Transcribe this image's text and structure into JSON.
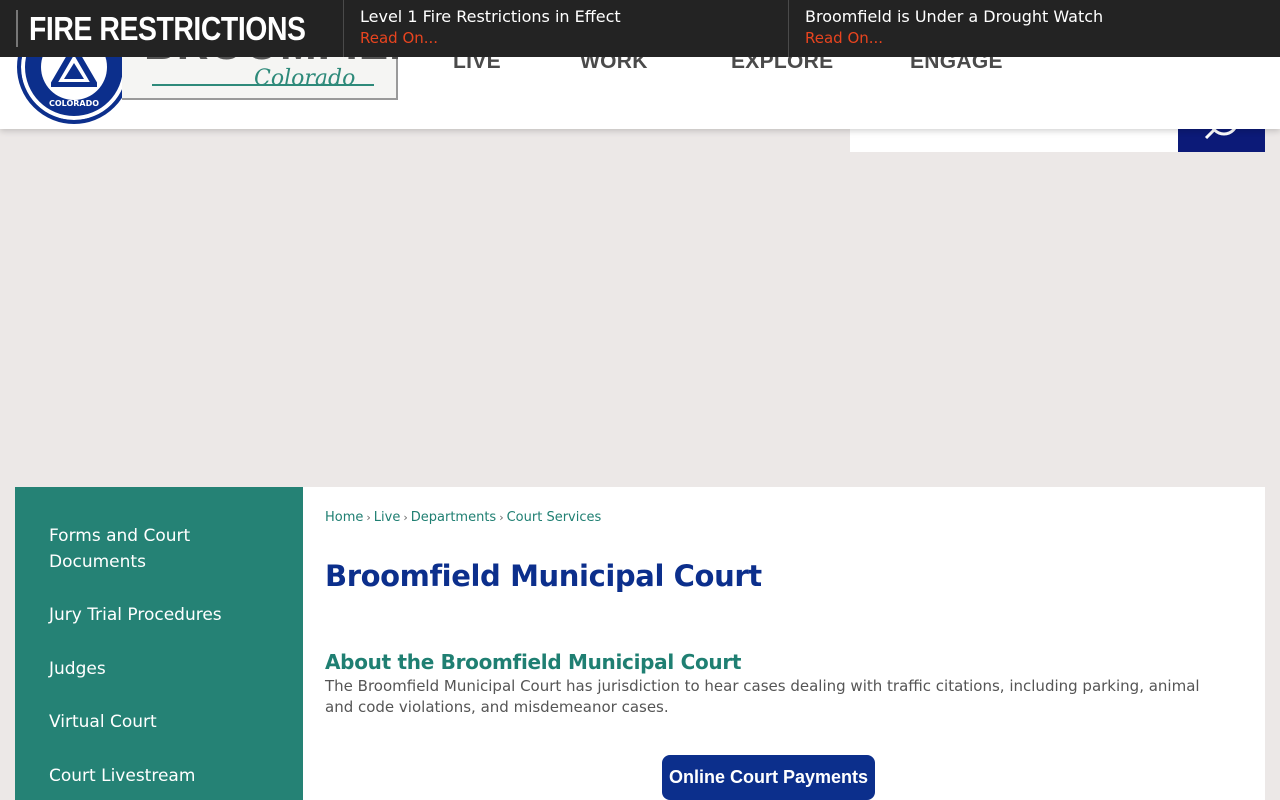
{
  "alerts": {
    "banner_title": "FIRE RESTRICTIONS",
    "items": [
      {
        "title": "Level 1 Fire Restrictions in Effect",
        "link": "Read On..."
      },
      {
        "title": "Broomfield is Under a Drought Watch",
        "link": "Read On..."
      }
    ]
  },
  "header": {
    "logo": {
      "wordmark": "BROOMFIELD",
      "script": "Colorado",
      "seal_text": "COLORADO"
    },
    "nav": [
      "LIVE",
      "WORK",
      "EXPLORE",
      "ENGAGE"
    ]
  },
  "search": {
    "placeholder": "",
    "button_icon": "search-icon"
  },
  "sidebar": {
    "items": [
      {
        "label": "Forms and Court Documents"
      },
      {
        "label": "Jury Trial Procedures"
      },
      {
        "label": "Judges"
      },
      {
        "label": "Virtual Court"
      },
      {
        "label": "Court Livestream"
      }
    ]
  },
  "breadcrumb": [
    "Home",
    "Live",
    "Departments",
    "Court Services"
  ],
  "page": {
    "title": "Broomfield Municipal Court",
    "section_heading": "About the Broomfield Municipal Court",
    "section_body": "The Broomfield Municipal Court has jurisdiction to hear cases dealing with traffic citations, including parking, animal and code violations, and misdemeanor cases.",
    "payments_button": "Online Court Payments"
  },
  "colors": {
    "alert_bar": "#232323",
    "alert_link": "#e8441f",
    "primary_blue": "#0c2f8c",
    "teal": "#258275",
    "page_bg": "#ece8e7"
  }
}
